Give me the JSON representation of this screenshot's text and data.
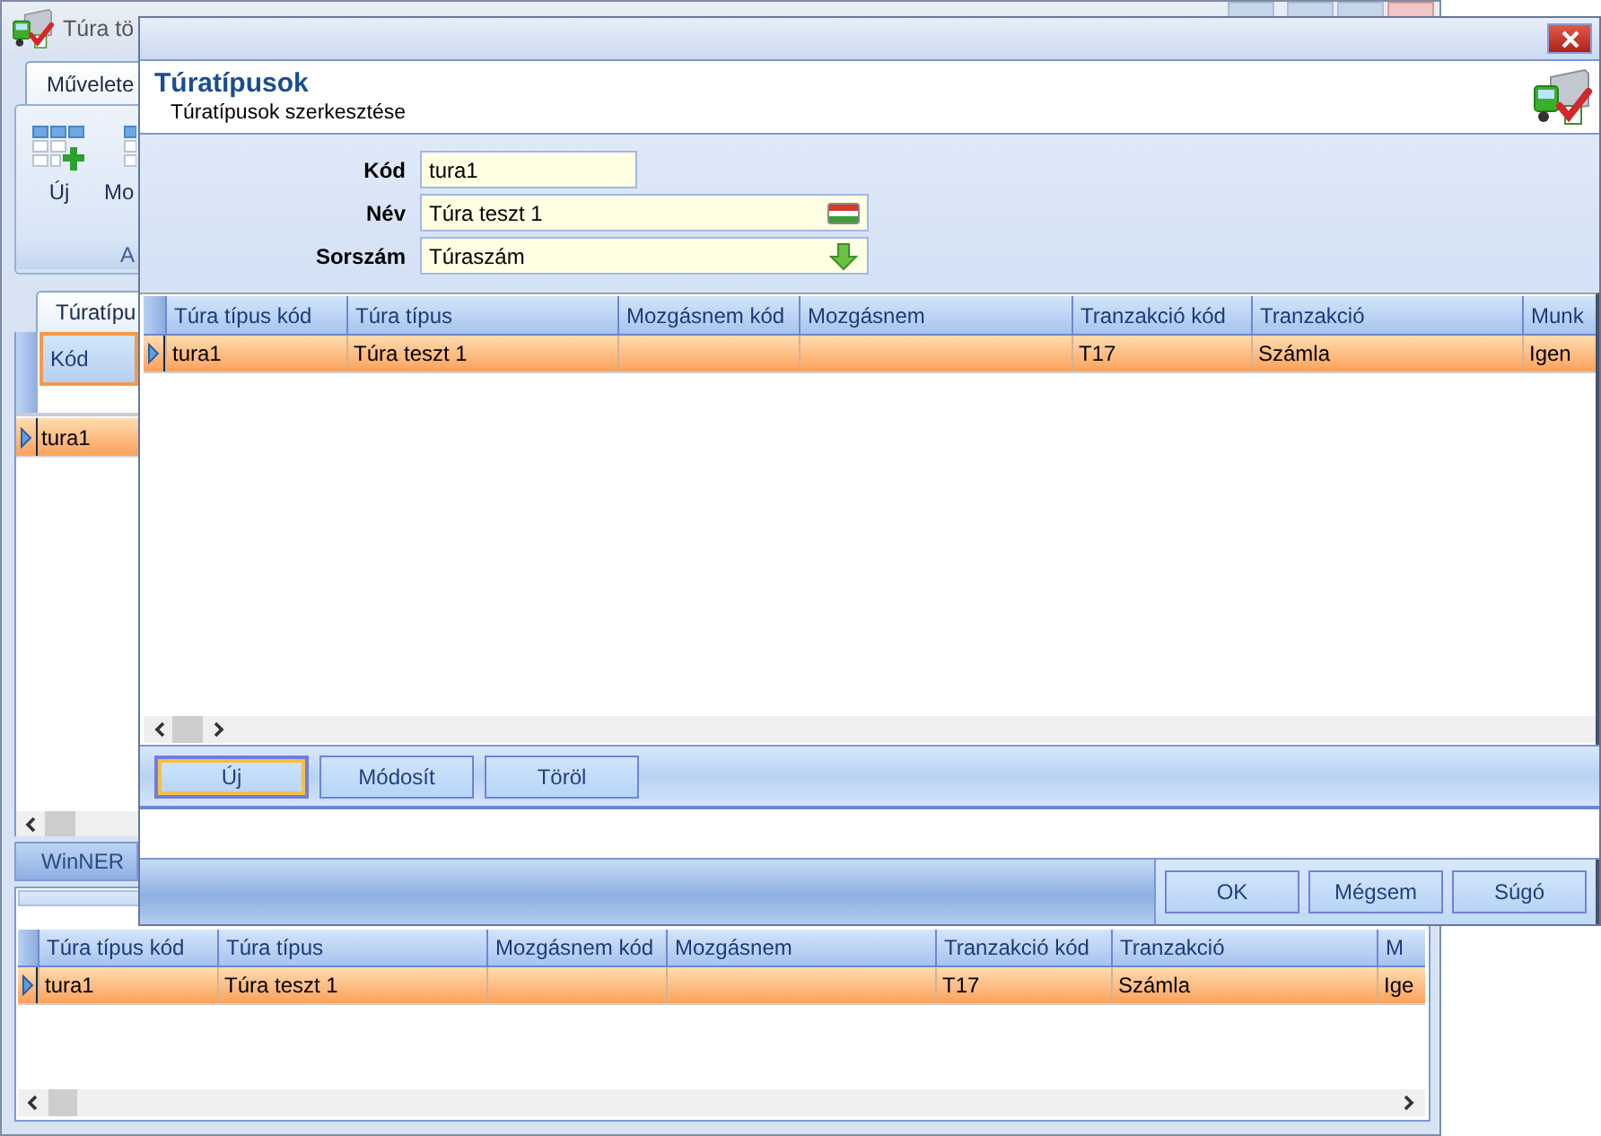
{
  "background_window": {
    "title": "Túra tö",
    "ribbon": {
      "tabs": [
        {
          "label": "Művelete",
          "selected": true
        }
      ],
      "buttons": [
        {
          "label": "Új",
          "kind": "new"
        },
        {
          "label": "Mo",
          "kind": "edit"
        }
      ],
      "group_label": "A"
    },
    "tabs": [
      {
        "label": "Túratípu",
        "selected": true
      }
    ],
    "grid": {
      "columns": [
        {
          "label": "Kód",
          "highlighted": true
        }
      ],
      "rows": [
        {
          "cells": [
            "tura1"
          ],
          "selected": true
        }
      ]
    },
    "pane_tab": "WinNER",
    "lower_grid": {
      "columns": [
        "Túra típus kód",
        "Túra típus",
        "Mozgásnem kód",
        "Mozgásnem",
        "Tranzakció kód",
        "Tranzakció",
        "M"
      ],
      "rows": [
        {
          "cells": [
            "tura1",
            "Túra teszt 1",
            null,
            null,
            "T17",
            "Számla",
            "Ige"
          ],
          "selected": true
        }
      ]
    }
  },
  "dialog": {
    "title": "Túratípusok",
    "subtitle": "Túratípusok szerkesztése",
    "fields": [
      {
        "label": "Kód",
        "value": "tura1",
        "kind": "text"
      },
      {
        "label": "Név",
        "value": "Túra teszt 1",
        "kind": "translatable"
      },
      {
        "label": "Sorszám",
        "value": "Túraszám",
        "kind": "dropdown"
      }
    ],
    "grid": {
      "columns": [
        "Túra típus kód",
        "Túra típus",
        "Mozgásnem kód",
        "Mozgásnem",
        "Tranzakció kód",
        "Tranzakció",
        "Munk"
      ],
      "rows": [
        {
          "cells": [
            "tura1",
            "Túra teszt 1",
            null,
            null,
            "T17",
            "Számla",
            "Igen"
          ],
          "selected": true
        }
      ]
    },
    "grid_buttons": [
      {
        "label": "Új",
        "focused": true
      },
      {
        "label": "Módosít",
        "focused": false
      },
      {
        "label": "Töröl",
        "focused": false
      }
    ],
    "buttons": [
      "OK",
      "Mégsem",
      "Súgó"
    ]
  }
}
